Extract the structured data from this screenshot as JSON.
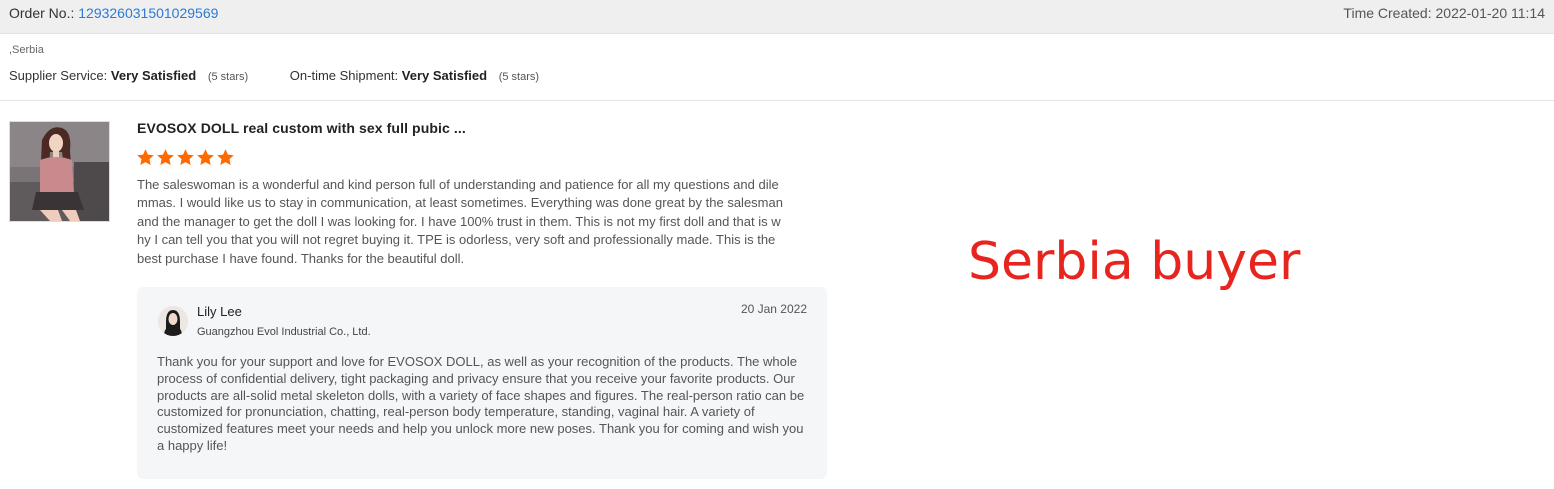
{
  "order": {
    "label": "Order No.:",
    "number": "129326031501029569",
    "time_label": "Time Created:",
    "time_value": "2022-01-20 11:14"
  },
  "buyer": {
    "location": ",Serbia"
  },
  "ratings": [
    {
      "label": "Supplier Service:",
      "value": "Very Satisfied",
      "stars_text": "(5 stars)"
    },
    {
      "label": "On-time Shipment:",
      "value": "Very Satisfied",
      "stars_text": "(5 stars)"
    }
  ],
  "review": {
    "product_title": "EVOSOX DOLL real custom with sex full pubic ...",
    "stars": 5,
    "star_color": "#ff6a00",
    "text": "The saleswoman is a wonderful and kind person full of understanding and patience for all my questions and dilemmas. I would like us to stay in communication, at least sometimes. Everything was done great by the salesman and the manager to get the doll I was looking for. I have 100% trust in them. This is not my first doll and that is why I can tell you that you will not regret buying it. TPE is odorless, very soft and professionally made. This is the best purchase I have found. Thanks for the beautiful doll."
  },
  "reply": {
    "seller_name": "Lily Lee",
    "company": "Guangzhou Evol Industrial Co., Ltd.",
    "date": "20 Jan 2022",
    "text": "Thank you for your support and love for EVOSOX DOLL, as well as your recognition of the products. The whole process of confidential delivery, tight packaging and privacy ensure that you receive your favorite products. Our products are all-solid metal skeleton dolls, with a variety of face shapes and figures. The real-person ratio can be customized for pronunciation, chatting, real-person body temperature, standing, vaginal hair. A variety of customized features meet your needs and help you unlock more new poses. Thank you for coming and wish you a happy life!"
  },
  "annotation": {
    "text": "Serbia buyer",
    "color": "#e8241f"
  },
  "colors": {
    "link": "#2b7bd6",
    "header_bg": "#efefef",
    "reply_bg": "#f5f6f8"
  }
}
